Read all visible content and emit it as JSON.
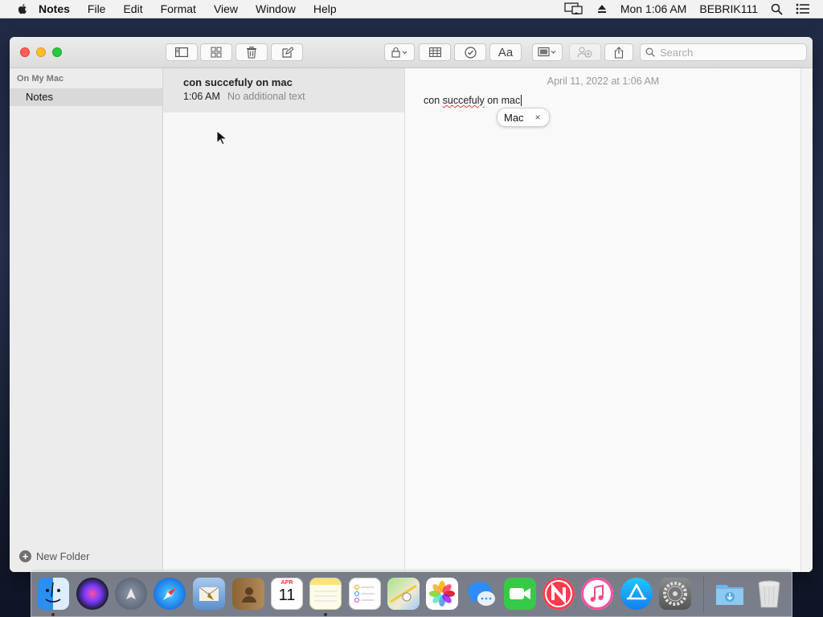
{
  "menubar": {
    "app_name": "Notes",
    "items": [
      "File",
      "Edit",
      "Format",
      "View",
      "Window",
      "Help"
    ],
    "clock": "Mon 1:06 AM",
    "user": "BEBRIK111"
  },
  "window": {
    "search_placeholder": "Search"
  },
  "sidebar": {
    "section_title": "On My Mac",
    "folder": "Notes",
    "new_folder_label": "New Folder"
  },
  "notelist": {
    "notes": [
      {
        "title": "con succefuly on mac",
        "time": "1:06 AM",
        "preview": "No additional text"
      }
    ]
  },
  "editor": {
    "date": "April 11, 2022 at 1:06 AM",
    "text_before": "con ",
    "text_misspelled": "succefuly",
    "text_middle": " on ",
    "text_last": "mac",
    "autocorrect_suggestion": "Mac",
    "autocorrect_dismiss": "×"
  },
  "dock": {
    "apps": [
      "finder-icon",
      "siri-icon",
      "launchpad-icon",
      "safari-icon",
      "mail-icon",
      "contacts-icon",
      "calendar-icon",
      "notes-icon",
      "reminders-icon",
      "maps-icon",
      "photos-icon",
      "messages-icon",
      "facetime-icon",
      "news-icon",
      "itunes-icon",
      "app-store-icon",
      "system-preferences-icon",
      "downloads-icon",
      "trash-icon"
    ],
    "calendar_month": "APR",
    "calendar_day": "11"
  },
  "colors": {
    "close": "#fe5f57",
    "minimize": "#febc2e",
    "zoom": "#28c840"
  }
}
